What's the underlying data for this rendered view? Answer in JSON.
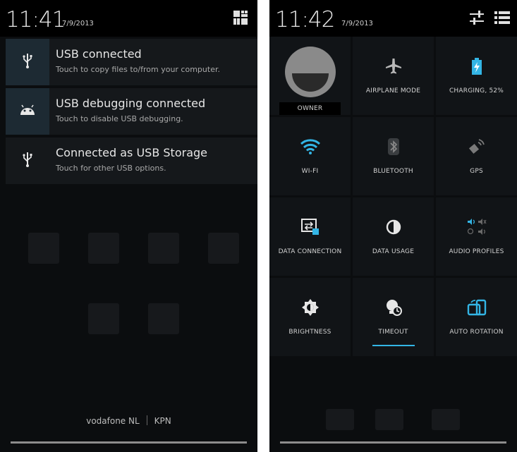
{
  "left_screen": {
    "status_bar": {
      "time": "11:41",
      "date": "7/9/2013",
      "action_icon": "notification-grid-icon"
    },
    "notifications": [
      {
        "title": "USB connected",
        "text": "Touch to copy files to/from your computer.",
        "icon": "usb-icon"
      },
      {
        "title": "USB debugging connected",
        "text": "Touch to disable USB debugging.",
        "icon": "android-icon"
      },
      {
        "title": "Connected as USB Storage",
        "text": "Touch for other USB options.",
        "icon": "usb-icon"
      }
    ],
    "carrier": {
      "primary": "vodafone NL",
      "secondary": "KPN"
    }
  },
  "right_screen": {
    "status_bar": {
      "time": "11:42",
      "date": "7/9/2013",
      "icons": [
        "settings-sliders-icon",
        "list-icon"
      ]
    },
    "tiles": [
      {
        "label": "OWNER",
        "icon": "avatar-icon"
      },
      {
        "label": "AIRPLANE MODE",
        "icon": "airplane-icon"
      },
      {
        "label": "CHARGING, 52%",
        "icon": "battery-charging-icon"
      },
      {
        "label": "WI-FI",
        "icon": "wifi-icon"
      },
      {
        "label": "BLUETOOTH",
        "icon": "bluetooth-icon"
      },
      {
        "label": "GPS",
        "icon": "gps-icon"
      },
      {
        "label": "DATA CONNECTION",
        "icon": "data-connection-icon"
      },
      {
        "label": "DATA USAGE",
        "icon": "data-usage-icon"
      },
      {
        "label": "AUDIO PROFILES",
        "icon": "audio-profiles-icon"
      },
      {
        "label": "BRIGHTNESS",
        "icon": "brightness-icon"
      },
      {
        "label": "TIMEOUT",
        "icon": "timeout-icon"
      },
      {
        "label": "AUTO ROTATION",
        "icon": "auto-rotation-icon"
      }
    ]
  },
  "colors": {
    "accent": "#33b5e5",
    "background": "#0b0d0f",
    "tile": "#111417"
  }
}
